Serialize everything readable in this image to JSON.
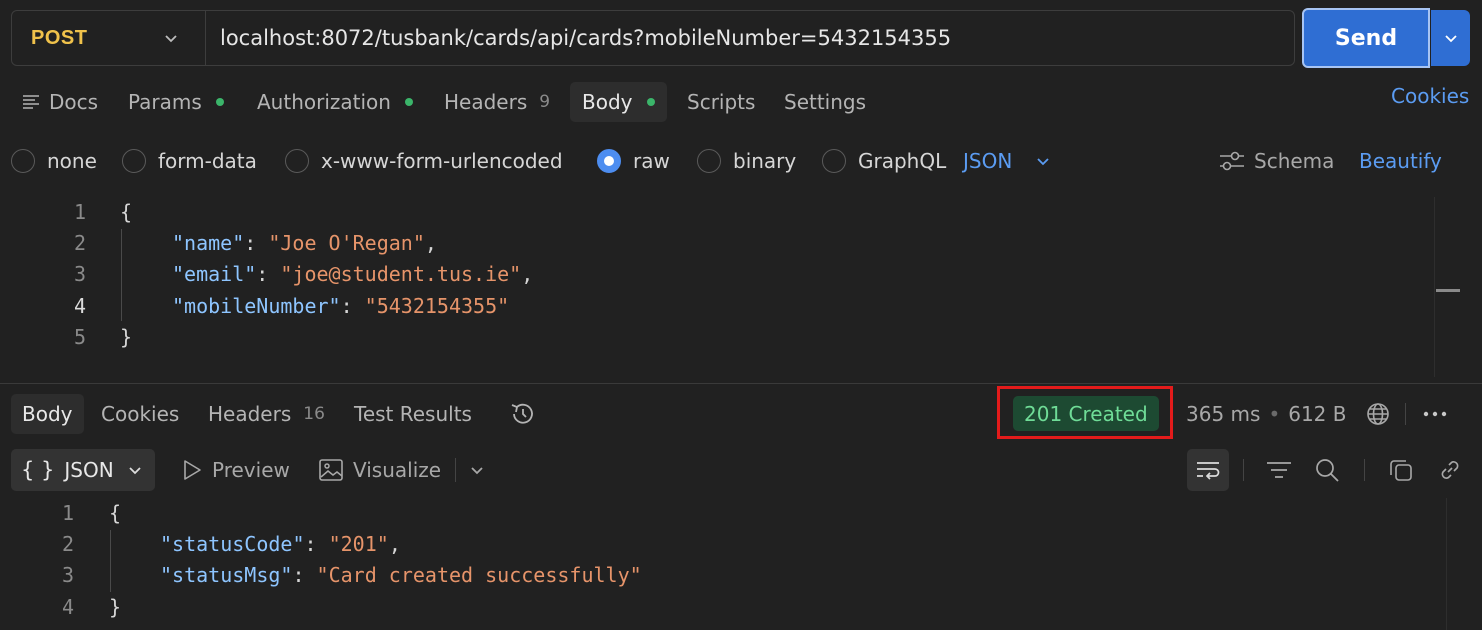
{
  "request": {
    "method": "POST",
    "url": "localhost:8072/tusbank/cards/api/cards?mobileNumber=5432154355",
    "send_label": "Send"
  },
  "request_tabs": {
    "docs": "Docs",
    "params": "Params",
    "authorization": "Authorization",
    "headers": "Headers",
    "headers_count": "9",
    "body": "Body",
    "scripts": "Scripts",
    "settings": "Settings",
    "cookies": "Cookies"
  },
  "body_types": {
    "none": "none",
    "form_data": "form-data",
    "urlencoded": "x-www-form-urlencoded",
    "raw": "raw",
    "binary": "binary",
    "graphql": "GraphQL",
    "selected": "raw",
    "format": "JSON",
    "schema": "Schema",
    "beautify": "Beautify"
  },
  "request_body": {
    "line_numbers": [
      "1",
      "2",
      "3",
      "4",
      "5"
    ],
    "open": "{",
    "close": "}",
    "fields": [
      {
        "key": "\"name\"",
        "value": "\"Joe O'Regan\"",
        "trail": ","
      },
      {
        "key": "\"email\"",
        "value": "\"joe@student.tus.ie\"",
        "trail": ","
      },
      {
        "key": "\"mobileNumber\"",
        "value": "\"5432154355\"",
        "trail": ""
      }
    ]
  },
  "response_tabs": {
    "body": "Body",
    "cookies": "Cookies",
    "headers": "Headers",
    "headers_count": "16",
    "test_results": "Test Results"
  },
  "response_meta": {
    "status": "201 Created",
    "time": "365 ms",
    "size": "612 B"
  },
  "response_toolbar": {
    "format": "JSON",
    "format_icon": "{ }",
    "preview": "Preview",
    "visualize": "Visualize"
  },
  "response_body": {
    "line_numbers": [
      "1",
      "2",
      "3",
      "4"
    ],
    "open": "{",
    "close": "}",
    "fields": [
      {
        "key": "\"statusCode\"",
        "value": "\"201\"",
        "trail": ","
      },
      {
        "key": "\"statusMsg\"",
        "value": "\"Card created successfully\"",
        "trail": ""
      }
    ]
  },
  "colors": {
    "accent": "#2f6ed3",
    "method": "#f0c24b",
    "link": "#5b9cf2",
    "status_success": "#6fdc97",
    "highlight_box": "#e31b1b"
  }
}
